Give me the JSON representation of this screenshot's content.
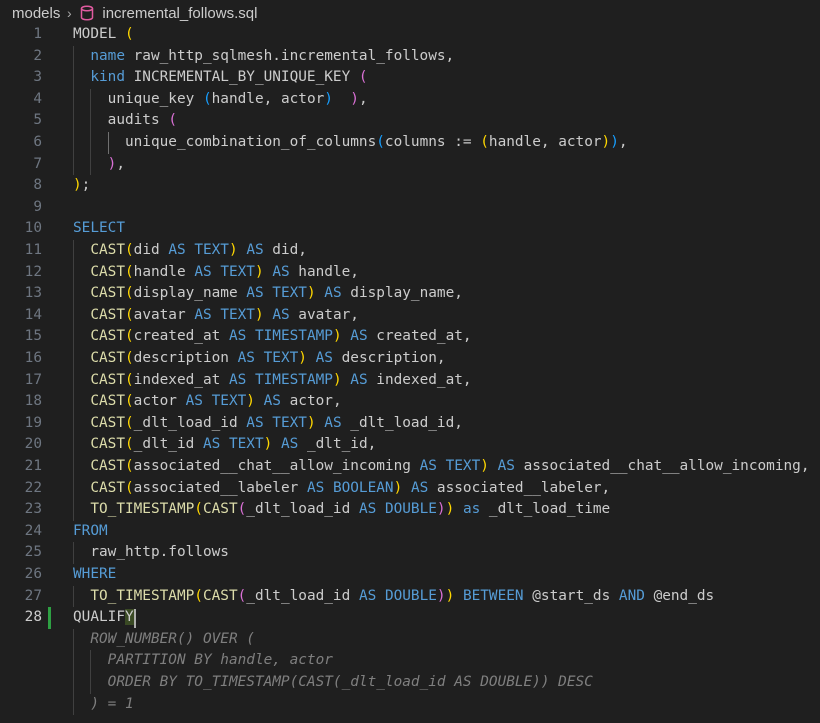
{
  "breadcrumb": {
    "folder": "models",
    "file": "incremental_follows.sql",
    "separator_icon": "chevron-right-icon",
    "file_icon": "database-icon"
  },
  "colors": {
    "background": "#1f1f1f",
    "keyword": "#569cd6",
    "function": "#dcdcaa",
    "bracket_gold": "#ffd700",
    "bracket_pink": "#da70d6",
    "bracket_blue": "#179fff",
    "modified_gutter": "#2ea043"
  },
  "editor": {
    "active_line": "28",
    "lines": [
      {
        "n": "1",
        "t": "MODEL ("
      },
      {
        "n": "2",
        "t": "  name raw_http_sqlmesh.incremental_follows,"
      },
      {
        "n": "3",
        "t": "  kind INCREMENTAL_BY_UNIQUE_KEY ("
      },
      {
        "n": "4",
        "t": "    unique_key (handle, actor)  ),"
      },
      {
        "n": "5",
        "t": "    audits ("
      },
      {
        "n": "6",
        "t": "      unique_combination_of_columns(columns := (handle, actor)),"
      },
      {
        "n": "7",
        "t": "    ),"
      },
      {
        "n": "8",
        "t": ");"
      },
      {
        "n": "9",
        "t": ""
      },
      {
        "n": "10",
        "t": "SELECT"
      },
      {
        "n": "11",
        "t": "  CAST(did AS TEXT) AS did,"
      },
      {
        "n": "12",
        "t": "  CAST(handle AS TEXT) AS handle,"
      },
      {
        "n": "13",
        "t": "  CAST(display_name AS TEXT) AS display_name,"
      },
      {
        "n": "14",
        "t": "  CAST(avatar AS TEXT) AS avatar,"
      },
      {
        "n": "15",
        "t": "  CAST(created_at AS TIMESTAMP) AS created_at,"
      },
      {
        "n": "16",
        "t": "  CAST(description AS TEXT) AS description,"
      },
      {
        "n": "17",
        "t": "  CAST(indexed_at AS TIMESTAMP) AS indexed_at,"
      },
      {
        "n": "18",
        "t": "  CAST(actor AS TEXT) AS actor,"
      },
      {
        "n": "19",
        "t": "  CAST(_dlt_load_id AS TEXT) AS _dlt_load_id,"
      },
      {
        "n": "20",
        "t": "  CAST(_dlt_id AS TEXT) AS _dlt_id,"
      },
      {
        "n": "21",
        "t": "  CAST(associated__chat__allow_incoming AS TEXT) AS associated__chat__allow_incoming,"
      },
      {
        "n": "22",
        "t": "  CAST(associated__labeler AS BOOLEAN) AS associated__labeler,"
      },
      {
        "n": "23",
        "t": "  TO_TIMESTAMP(CAST(_dlt_load_id AS DOUBLE)) as _dlt_load_time"
      },
      {
        "n": "24",
        "t": "FROM"
      },
      {
        "n": "25",
        "t": "  raw_http.follows"
      },
      {
        "n": "26",
        "t": "WHERE"
      },
      {
        "n": "27",
        "t": "  TO_TIMESTAMP(CAST(_dlt_load_id AS DOUBLE)) BETWEEN @start_ds AND @end_ds"
      },
      {
        "n": "28",
        "t": "QUALIFY"
      },
      {
        "n": "",
        "t": "  ROW_NUMBER() OVER (",
        "ghost": true
      },
      {
        "n": "",
        "t": "    PARTITION BY handle, actor",
        "ghost": true
      },
      {
        "n": "",
        "t": "    ORDER BY TO_TIMESTAMP(CAST(_dlt_load_id AS DOUBLE)) DESC",
        "ghost": true
      },
      {
        "n": "",
        "t": "  ) = 1",
        "ghost": true
      }
    ]
  }
}
